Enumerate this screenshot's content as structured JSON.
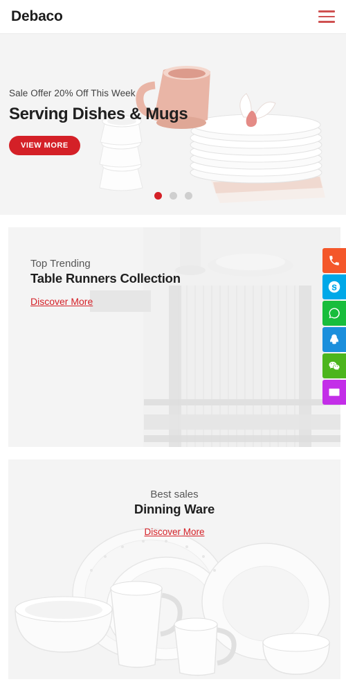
{
  "header": {
    "logo": "Debaco",
    "menu_icon": "hamburger-icon"
  },
  "hero": {
    "subtitle": "Sale Offer 20% Off This Week",
    "title": "Serving Dishes & Mugs",
    "button_label": "VIEW MORE",
    "accent_color": "#d42027",
    "background_color": "#f4f4f4",
    "carousel": {
      "total": 3,
      "active_index": 0
    }
  },
  "cards": [
    {
      "id": "card-trending",
      "subtitle": "Top Trending",
      "title": "Table Runners Collection",
      "link_label": "Discover More",
      "align": "left"
    },
    {
      "id": "card-dinning",
      "subtitle": "Best sales",
      "title": "Dinning Ware",
      "link_label": "Discover More",
      "align": "center"
    }
  ],
  "contact_bar": {
    "items": [
      {
        "name": "phone-icon",
        "label": "Phone",
        "color": "#f4572a"
      },
      {
        "name": "skype-icon",
        "label": "Skype",
        "color": "#00a8e8"
      },
      {
        "name": "whatsapp-icon",
        "label": "WhatsApp",
        "color": "#18bd3c"
      },
      {
        "name": "qq-icon",
        "label": "QQ",
        "color": "#1b8fdc"
      },
      {
        "name": "wechat-icon",
        "label": "WeChat",
        "color": "#4cb51d"
      },
      {
        "name": "email-icon",
        "label": "Email",
        "color": "#c32ee8"
      }
    ]
  }
}
